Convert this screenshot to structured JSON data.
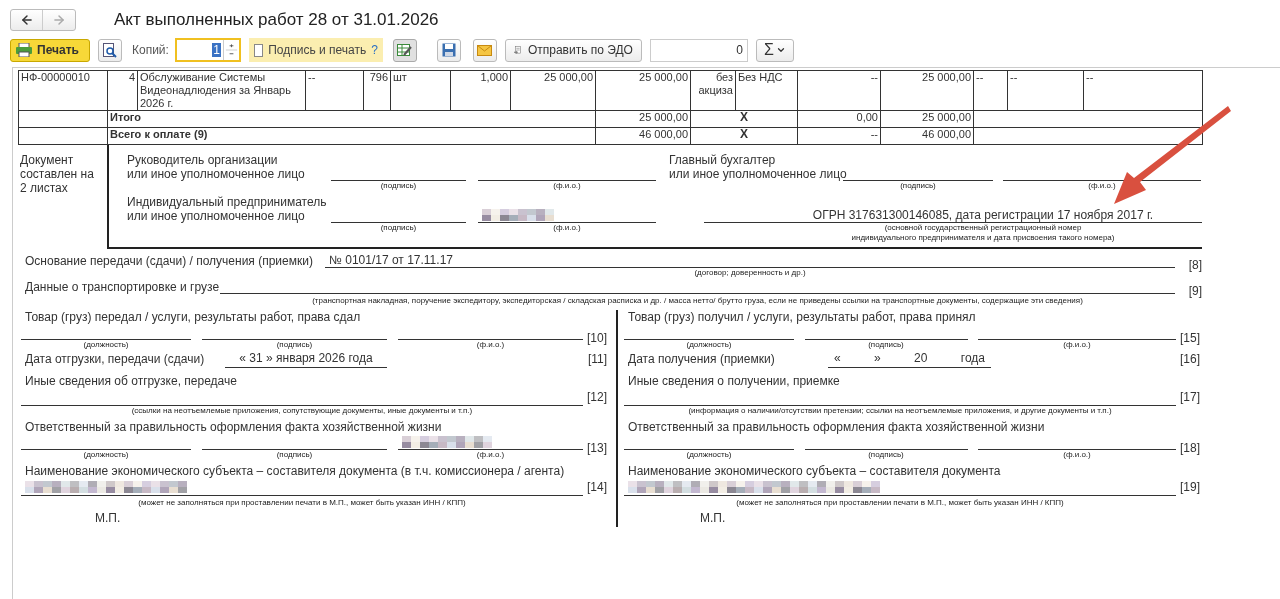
{
  "window": {
    "title": "Акт выполненных работ 28 от 31.01.2026"
  },
  "toolbar": {
    "print_button": "Печать",
    "copies_label": "Копий:",
    "copies_value": "1",
    "sign_and_print": {
      "label": "Подпись и печать",
      "checked": false,
      "help": "?"
    },
    "send_edo_button": "Отправить по ЭДО",
    "counter_value": "0",
    "sum_button": "Σ"
  },
  "items_table": {
    "rows": [
      {
        "cells": [
          "НФ-00000010",
          "4",
          "Обслуживание Системы Видеонадлюдения за Январь 2026 г.",
          "--",
          "796",
          "шт",
          "1,000",
          "25 000,00",
          "25 000,00",
          "без акциза",
          "Без НДС",
          "--",
          "25 000,00",
          "--",
          "--",
          "--"
        ]
      }
    ],
    "totals": [
      {
        "label": "Итого",
        "amount": "25 000,00",
        "mark": "X",
        "tax": "0,00",
        "total": "25 000,00"
      },
      {
        "label": "Всего к оплате (9)",
        "amount": "46 000,00",
        "mark": "X",
        "tax": "--",
        "total": "46 000,00"
      }
    ]
  },
  "signatures": {
    "pages_note": "Документ составлен на 2 листах",
    "head": {
      "label_lines": [
        "Руководитель организации",
        "или иное уполномоченное лицо"
      ],
      "captions": [
        "(подпись)",
        "(ф.и.о.)"
      ]
    },
    "chief_accountant": {
      "label_lines": [
        "Главный бухгалтер",
        "или иное уполномоченное лицо"
      ],
      "captions": [
        "(подпись)",
        "(ф.и.о.)"
      ]
    },
    "entrepreneur": {
      "label_lines": [
        "Индивидуальный предприниматель",
        "или иное уполномоченное лицо"
      ],
      "captions": [
        "(подпись)",
        "(ф.и.о.)"
      ],
      "redacted": true
    },
    "registration": {
      "value": "ОГРН 317631300146085, дата регистрации 17 ноября 2017 г.",
      "caption_lines": [
        "(основной государственный регистрационный номер",
        "индивидуального предпринимателя и дата присвоения такого номера)"
      ]
    }
  },
  "basis": {
    "label": "Основание передачи (сдачи) / получения (приемки)",
    "value": "№ 0101/17 от 17.11.17",
    "caption": "(договор; доверенность и др.)",
    "number": "[8]"
  },
  "transport": {
    "label": "Данные о транспортировке и грузе",
    "caption": "(транспортная накладная, поручение экспедитору, экспедиторская / складская расписка и др. / масса нетто/ брутто груза, если не приведены ссылки на транспортные документы, содержащие эти сведения)",
    "number": "[9]"
  },
  "transfer": {
    "left": {
      "handed": {
        "title": "Товар (груз) передал / услуги, результаты работ, права сдал",
        "captions": [
          "(должность)",
          "(подпись)",
          "(ф.и.о.)"
        ],
        "number": "[10]"
      },
      "date": {
        "label": "Дата отгрузки, передачи (сдачи)",
        "parts": [
          "« 31 » января 2026 года"
        ],
        "number": "[11]"
      },
      "other": {
        "title": "Иные сведения об отгрузке, передаче",
        "caption": "(ссылки на неотъемлемые приложения, сопутствующие документы, иные документы и т.п.)",
        "number": "[12]"
      },
      "responsible": {
        "title": "Ответственный за правильность оформления факта хозяйственной жизни",
        "captions": [
          "(должность)",
          "(подпись)",
          "(ф.и.о.)"
        ],
        "number": "[13]",
        "redacted": true
      },
      "entity": {
        "title": "Наименование экономического субъекта – составителя документа (в т.ч. комиссионера / агента)",
        "caption": "(может не заполняться при проставлении печати в М.П., может быть указан ИНН / КПП)",
        "number": "[14]",
        "redacted": true
      },
      "stamp": "М.П."
    },
    "right": {
      "handed": {
        "title": "Товар (груз) получил / услуги, результаты работ, права принял",
        "captions": [
          "(должность)",
          "(подпись)",
          "(ф.и.о.)"
        ],
        "number": "[15]"
      },
      "date": {
        "label": "Дата получения (приемки)",
        "parts": [
          "«",
          "»",
          "20",
          "года"
        ],
        "number": "[16]"
      },
      "other": {
        "title": "Иные сведения о получении, приемке",
        "caption": "(информация о наличии/отсутствии претензии; ссылки на неотъемлемые приложения, и другие  документы и т.п.)",
        "number": "[17]"
      },
      "responsible": {
        "title": "Ответственный за правильность оформления факта хозяйственной жизни",
        "captions": [
          "(должность)",
          "(подпись)",
          "(ф.и.о.)"
        ],
        "number": "[18]"
      },
      "entity": {
        "title": "Наименование экономического субъекта – составителя документа",
        "caption": "(может не заполняться при проставлении печати в М.П., может быть указан ИНН / КПП)",
        "number": "[19]",
        "redacted": true
      },
      "stamp": "М.П."
    }
  }
}
